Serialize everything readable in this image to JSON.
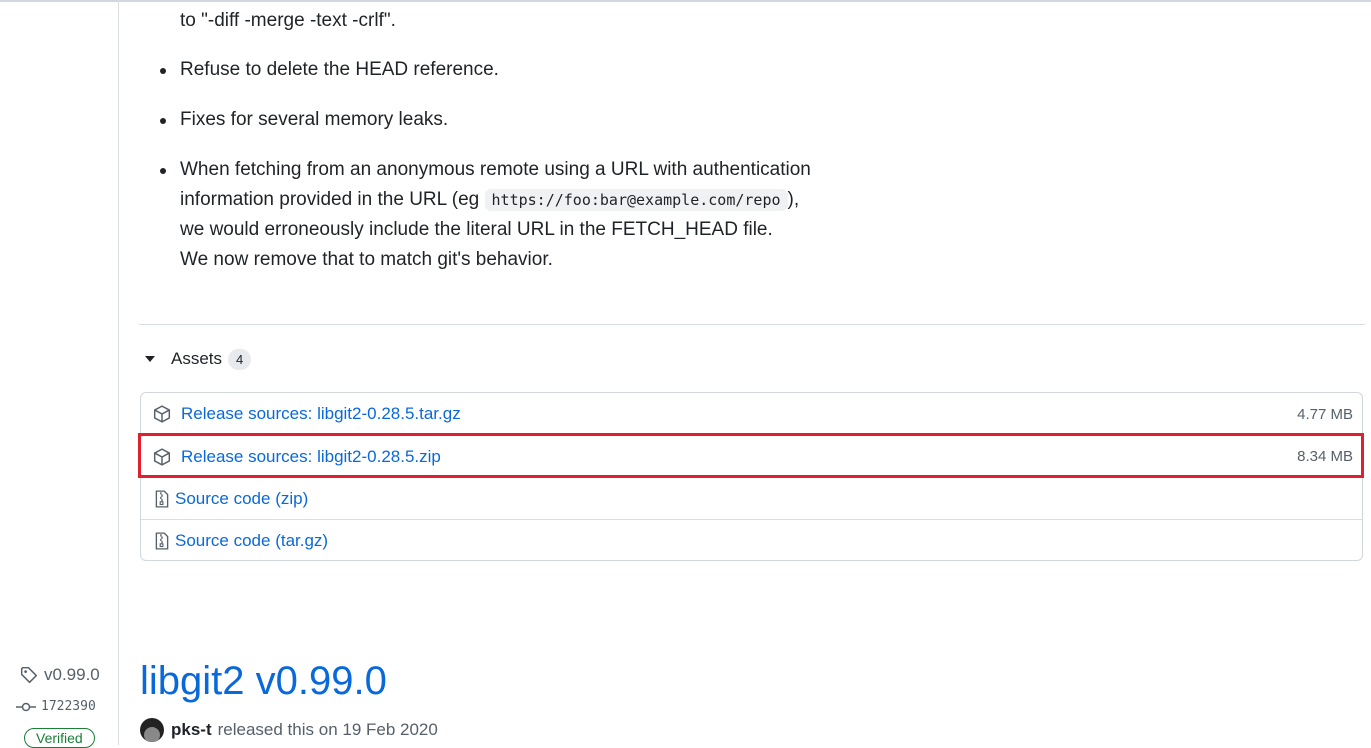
{
  "notes": {
    "continuation": "to \"-diff -merge -text -crlf\".",
    "bullets": [
      {
        "text": "Refuse to delete the HEAD reference."
      },
      {
        "text": "Fixes for several memory leaks."
      }
    ],
    "fetch_bullet": {
      "line1": "When fetching from an anonymous remote using a URL with authentication",
      "line2_before": "information provided in the URL (eg ",
      "line2_code": "https://foo:bar@example.com/repo",
      "line2_after": "),",
      "line3": "we would erroneously include the literal URL in the FETCH_HEAD file.",
      "line4": "We now remove that to match git's behavior."
    }
  },
  "assets": {
    "title": "Assets",
    "count": "4",
    "items": [
      {
        "icon": "package-icon",
        "label": "Release sources: libgit2-0.28.5.tar.gz",
        "size": "4.77 MB"
      },
      {
        "icon": "package-icon",
        "label": "Release sources: libgit2-0.28.5.zip",
        "size": "8.34 MB"
      },
      {
        "icon": "file-zip-icon",
        "label": "Source code",
        "ext": "(zip)"
      },
      {
        "icon": "file-zip-icon",
        "label": "Source code",
        "ext": "(tar.gz)"
      }
    ]
  },
  "next_release": {
    "tag": "v0.99.0",
    "commit": "1722390",
    "verified": "Verified",
    "title": "libgit2 v0.99.0",
    "author": "pks-t",
    "released_text": "released this on 19 Feb 2020"
  },
  "colors": {
    "link": "#0969da",
    "highlight": "#e0202e",
    "verified": "#1a7f37"
  }
}
